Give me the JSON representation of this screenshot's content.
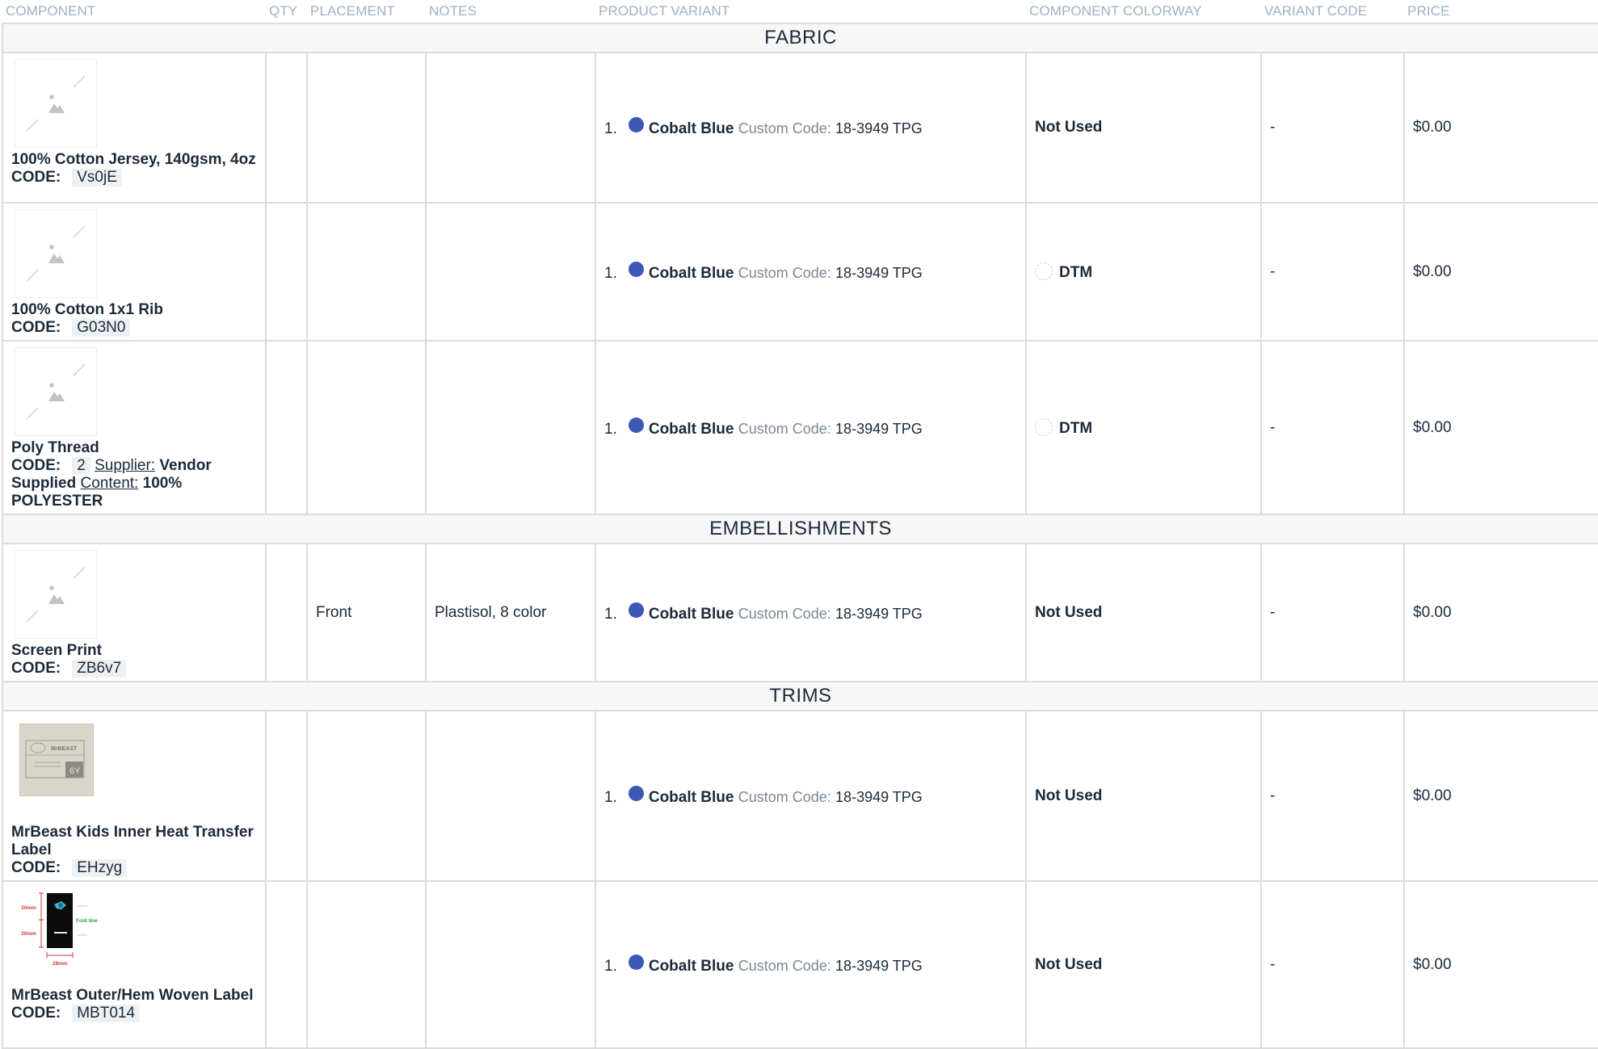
{
  "headers": {
    "component": "COMPONENT",
    "qty": "QTY",
    "placement": "PLACEMENT",
    "notes": "NOTES",
    "product_variant": "PRODUCT VARIANT",
    "component_colorway": "COMPONENT COLORWAY",
    "variant_code": "VARIANT CODE",
    "price": "PRICE"
  },
  "labels": {
    "code": "CODE:",
    "custom_code": "Custom Code:",
    "supplier": "Supplier:",
    "content": "Content:"
  },
  "sections": {
    "fabric": "FABRIC",
    "embellishments": "EMBELLISHMENTS",
    "trims": "TRIMS"
  },
  "variant": {
    "number": "1.",
    "name": "Cobalt Blue",
    "custom_code": "18-3949 TPG",
    "color": "#3d57b4"
  },
  "rows": [
    {
      "name": "100% Cotton Jersey, 140gsm, 4oz",
      "code": "Vs0jE",
      "qty": "",
      "placement": "",
      "notes": "",
      "colorway": "Not Used",
      "variant_code": "-",
      "price": "$0.00",
      "image": "placeholder-icon"
    },
    {
      "name": "100% Cotton 1x1 Rib",
      "code": "G03N0",
      "qty": "",
      "placement": "",
      "notes": "",
      "colorway": "DTM",
      "variant_code": "-",
      "price": "$0.00",
      "image": "placeholder-icon"
    },
    {
      "name": "Poly Thread",
      "code": "2",
      "supplier": "Vendor Supplied",
      "content": "100% POLYESTER",
      "qty": "",
      "placement": "",
      "notes": "",
      "colorway": "DTM",
      "variant_code": "-",
      "price": "$0.00",
      "image": "placeholder-icon"
    },
    {
      "name": "Screen Print",
      "code": "ZB6v7",
      "qty": "",
      "placement": "Front",
      "notes": "Plastisol, 8 color",
      "colorway": "Not Used",
      "variant_code": "-",
      "price": "$0.00",
      "image": "placeholder-icon"
    },
    {
      "name": "MrBeast Kids Inner Heat Transfer Label",
      "code": "EHzyg",
      "qty": "",
      "placement": "",
      "notes": "",
      "colorway": "Not Used",
      "variant_code": "-",
      "price": "$0.00",
      "image": "label-thumbnail",
      "image_text": {
        "brand": "MrBEAST",
        "size": "6Y"
      }
    },
    {
      "name": "MrBeast Outer/Hem Woven Label",
      "code": "MBT014",
      "qty": "",
      "placement": "",
      "notes": "",
      "colorway": "Not Used",
      "variant_code": "-",
      "price": "$0.00",
      "image": "woven-label-diagram",
      "image_text": {
        "dim_top": "30mm",
        "dim_bottom": "30mm",
        "dim_width": "28mm",
        "fold": "Fold line"
      }
    }
  ]
}
